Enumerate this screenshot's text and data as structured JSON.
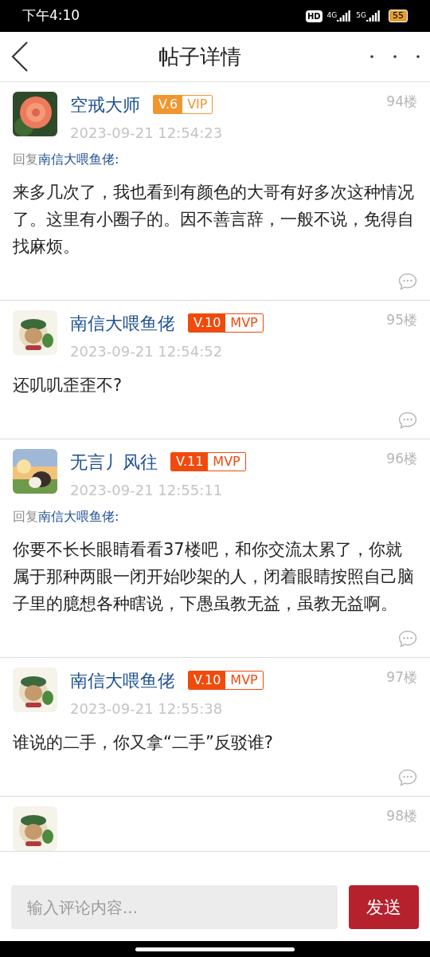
{
  "status_bar": {
    "time": "下午4:10",
    "hd": "HD",
    "networks": [
      "4G",
      "5G"
    ],
    "battery": "55"
  },
  "header": {
    "title": "帖子详情"
  },
  "posts": [
    {
      "name": "空戒大师",
      "level": "V.6",
      "badge": "VIP",
      "color": "#f0962e",
      "date": "2023-09-21 12:54:23",
      "floor": "94楼",
      "reply_label": "回复",
      "reply_to": "南信大喂鱼佬:",
      "body": "来多几次了，我也看到有颜色的大哥有好多次这种情况了。这里有小圈子的。因不善言辞，一般不说，免得自找麻烦。"
    },
    {
      "name": "南信大喂鱼佬",
      "level": "V.10",
      "badge": "MVP",
      "color": "#f04a0c",
      "date": "2023-09-21 12:54:52",
      "floor": "95楼",
      "body": "还叽叽歪歪不?"
    },
    {
      "name": "无言丿风往",
      "level": "V.11",
      "badge": "MVP",
      "color": "#f04a0c",
      "date": "2023-09-21 12:55:11",
      "floor": "96楼",
      "reply_label": "回复",
      "reply_to": "南信大喂鱼佬:",
      "body": "你要不长长眼睛看看37楼吧，和你交流太累了，你就属于那种两眼一闭开始吵架的人，闭着眼睛按照自己脑子里的臆想各种瞎说，下愚虽教无益，虽教无益啊。"
    },
    {
      "name": "南信大喂鱼佬",
      "level": "V.10",
      "badge": "MVP",
      "color": "#f04a0c",
      "date": "2023-09-21 12:55:38",
      "floor": "97楼",
      "body": "谁说的二手，你又拿“二手”反驳谁?"
    },
    {
      "floor": "98楼"
    }
  ],
  "comment_bar": {
    "placeholder": "输入评论内容...",
    "send": "发送"
  }
}
